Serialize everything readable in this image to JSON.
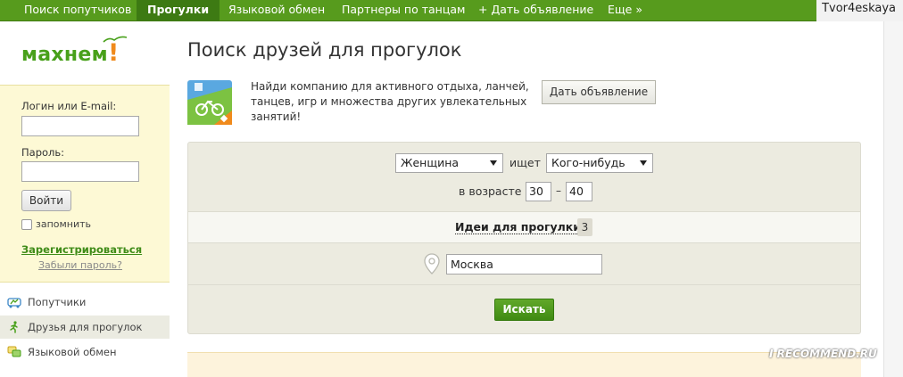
{
  "topnav": {
    "items": [
      {
        "label": "Поиск попутчиков"
      },
      {
        "label": "Прогулки"
      },
      {
        "label": "Языковой обмен"
      },
      {
        "label": "Партнеры по танцам"
      },
      {
        "label": "+ Дать объявление"
      },
      {
        "label": "Еще »"
      }
    ],
    "active_index": 1,
    "username": "Tvor4eskaya"
  },
  "logo": {
    "text": "махнем",
    "bang": "!"
  },
  "login": {
    "login_label": "Логин или E-mail:",
    "login_value": "",
    "password_label": "Пароль:",
    "password_value": "",
    "submit_label": "Войти",
    "remember_label": "запомнить",
    "remember_checked": false,
    "register_link": "Зарегистрироваться",
    "forgot_link": "Забыли пароль?"
  },
  "sidebar": {
    "items": [
      {
        "label": "Попутчики",
        "icon": "car-icon"
      },
      {
        "label": "Друзья для прогулок",
        "icon": "walking-person-icon"
      },
      {
        "label": "Языковой обмен",
        "icon": "speech-bubbles-icon"
      }
    ],
    "active_index": 1
  },
  "main": {
    "title": "Поиск друзей для прогулок",
    "promo_text": "Найди компанию для активного отдыха, ланчей, танцев, игр и множества других увлекательных занятий!",
    "post_button": "Дать объявление",
    "promo_icon": "bicycle-badge-icon"
  },
  "search": {
    "gender_value": "Женщина",
    "seeks_text": "ищет",
    "target_value": "Кого-нибудь",
    "age_label": "в возрасте",
    "age_from": "30",
    "age_dash": "–",
    "age_to": "40",
    "ideas_label": "Идеи для прогулки",
    "ideas_count": "3",
    "city_value": "Москва",
    "submit_label": "Искать"
  },
  "watermark": "I RECOMMEND.RU",
  "colors": {
    "nav_green": "#579b1d",
    "nav_active": "#3d7a13",
    "logo_green": "#48a01a",
    "logo_orange": "#f08a1c",
    "panel_bg": "#ecebe0",
    "login_bg": "#fdf9d5",
    "button_green": "#4f9b1f"
  }
}
